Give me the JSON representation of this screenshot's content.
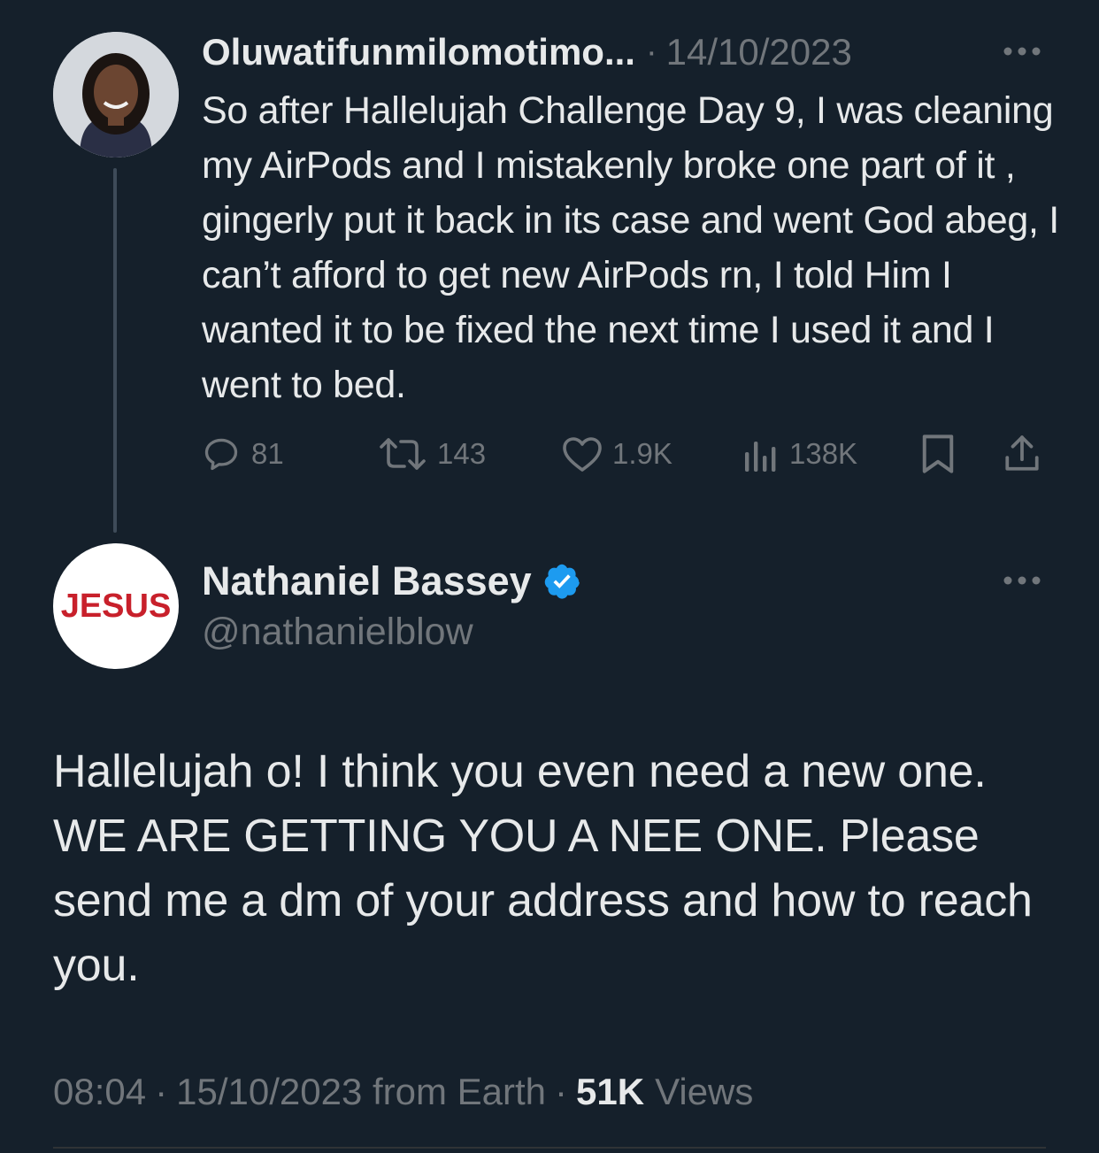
{
  "reply": {
    "display_name": "Oluwatifunmilomotimo...",
    "separator": "·",
    "date": "14/10/2023",
    "text": "So after Hallelujah Challenge Day 9, I was cleaning my AirPods and I mistakenly broke one part of it , gingerly put it back in its case and went God abeg, I can’t afford to get new AirPods rn, I told Him I wanted it to be fixed the next time I used it and I went to bed.",
    "stats": {
      "replies": "81",
      "retweets": "143",
      "likes": "1.9K",
      "views": "138K"
    }
  },
  "main_tweet": {
    "avatar_text": "JESUS",
    "display_name": "Nathaniel Bassey",
    "handle": "@nathanielblow",
    "text": "Hallelujah o! I think you even need a new one. WE ARE GETTING YOU A NEE ONE. Please send me a dm of your address and how to reach you.",
    "time": "08:04",
    "separator": "·",
    "date_source": "15/10/2023 from Earth",
    "views_count": "51K",
    "views_label": "Views"
  },
  "colors": {
    "background": "#15202b",
    "text_primary": "#e7e9ea",
    "text_secondary": "#71767b",
    "verified_blue": "#1d9bf0",
    "avatar_text_red": "#c8202b"
  },
  "icons": [
    "more-icon",
    "reply-icon",
    "retweet-icon",
    "like-icon",
    "views-icon",
    "bookmark-icon",
    "share-icon",
    "verified-badge-icon"
  ]
}
